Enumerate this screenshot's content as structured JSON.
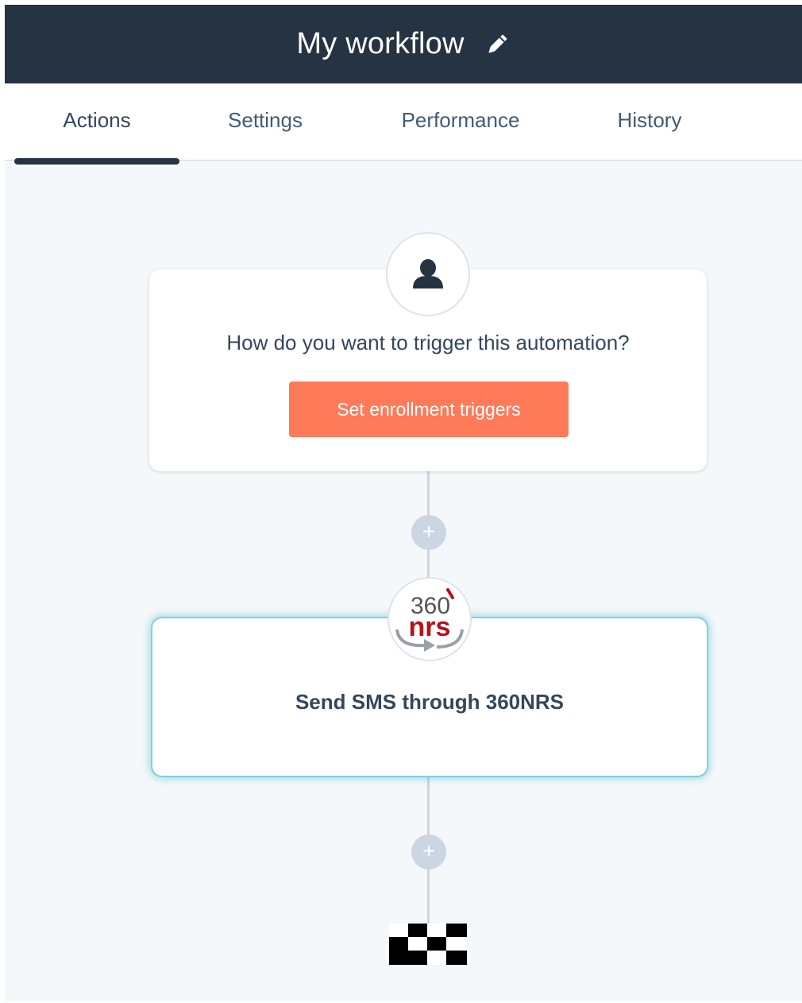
{
  "header": {
    "title": "My workflow",
    "edit_icon": "pencil-icon"
  },
  "tabs": [
    {
      "label": "Actions",
      "active": true
    },
    {
      "label": "Settings",
      "active": false
    },
    {
      "label": "Performance",
      "active": false
    },
    {
      "label": "History",
      "active": false
    }
  ],
  "trigger_card": {
    "icon": "contact-avatar-icon",
    "question": "How do you want to trigger this automation?",
    "button_label": "Set enrollment triggers"
  },
  "add_action_icon": "plus-icon",
  "action_card": {
    "logo_text_top": "360",
    "logo_text_bottom": "nrs",
    "label": "Send SMS through 360NRS"
  },
  "end_icon": "checkered-flag-icon",
  "colors": {
    "header_bg": "#253342",
    "trigger_button": "#ff7a59",
    "logo_red": "#b5121b",
    "selected_card_glow": "#7fd1de"
  }
}
